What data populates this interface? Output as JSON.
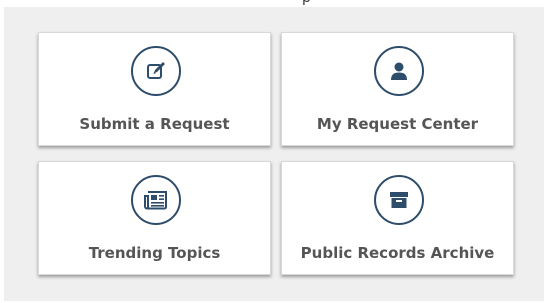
{
  "cards": [
    {
      "label": "Submit a Request",
      "icon": "edit-icon"
    },
    {
      "label": "My Request Center",
      "icon": "user-icon"
    },
    {
      "label": "Trending Topics",
      "icon": "newspaper-icon"
    },
    {
      "label": "Public Records Archive",
      "icon": "archive-box-icon"
    }
  ],
  "colors": {
    "icon": "#2e4d6b",
    "label": "#555555",
    "panel_background": "#efefef",
    "card_background": "#ffffff"
  }
}
